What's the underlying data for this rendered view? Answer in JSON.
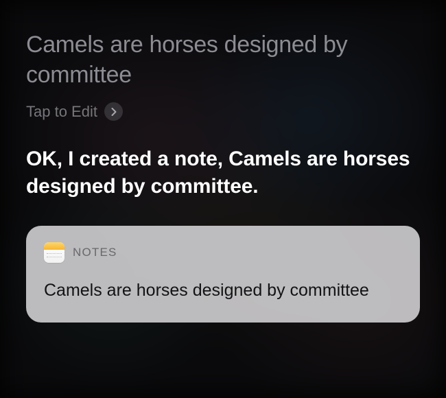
{
  "accent_color": "#f7b732",
  "user": {
    "utterance": "Camels are horses designed by committee",
    "edit_label": "Tap to Edit"
  },
  "siri": {
    "response": "OK, I created a note, Camels are horses designed by committee."
  },
  "card": {
    "app_label": "NOTES",
    "icon_name": "notes-app-icon",
    "note_text": "Camels are horses designed by committee"
  }
}
